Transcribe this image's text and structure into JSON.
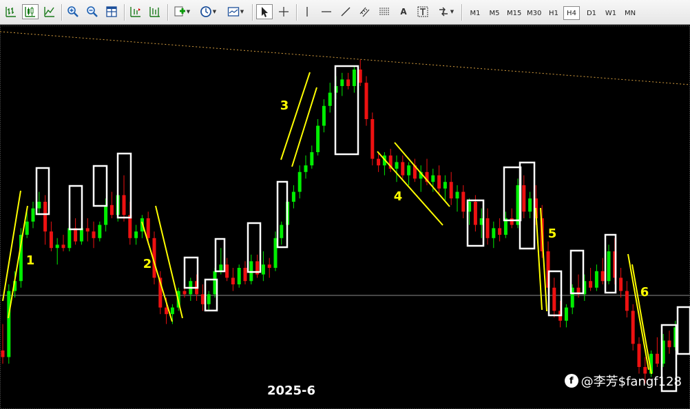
{
  "toolbar": {
    "timeframes": [
      {
        "label": "M1",
        "active": false
      },
      {
        "label": "M5",
        "active": false
      },
      {
        "label": "M15",
        "active": false
      },
      {
        "label": "M30",
        "active": false
      },
      {
        "label": "H1",
        "active": false
      },
      {
        "label": "H4",
        "active": true
      },
      {
        "label": "D1",
        "active": false
      },
      {
        "label": "W1",
        "active": false
      },
      {
        "label": "MN",
        "active": false
      }
    ],
    "tools": {
      "text_tool_label": "A"
    },
    "icons": [
      "bar-chart-icon",
      "candlestick-icon",
      "line-chart-icon",
      "zoom-in-icon",
      "zoom-out-icon",
      "tile-windows-icon",
      "chart-shift-icon",
      "autoscroll-icon",
      "new-indicator-icon",
      "periods-clock-icon",
      "templates-icon",
      "cursor-icon",
      "crosshair-icon",
      "vertical-line-icon",
      "horizontal-line-icon",
      "trendline-icon",
      "equidistant-channel-icon",
      "fibonacci-icon",
      "text-label-icon",
      "arrows-icon"
    ]
  },
  "chart": {
    "period_label": "2025-6",
    "watermark": "@李芳$fangf128",
    "wave_labels": [
      "1",
      "2",
      "3",
      "4",
      "5",
      "6"
    ],
    "colors": {
      "background": "#000000",
      "bull": "#00ee00",
      "bear": "#ee1111",
      "annotation": "#ffff00",
      "box": "#ffffff",
      "resistance": "#d8a040",
      "hline": "#8c8c8c"
    }
  },
  "chart_data": {
    "type": "candlestick",
    "timeframe": "H4",
    "title": "",
    "xlabel": "2025-6",
    "ylabel": "",
    "ohlc_relative": [
      [
        0.1,
        0.18,
        0.06,
        0.08
      ],
      [
        0.08,
        0.3,
        0.06,
        0.28
      ],
      [
        0.28,
        0.34,
        0.26,
        0.31
      ],
      [
        0.31,
        0.47,
        0.29,
        0.45
      ],
      [
        0.45,
        0.52,
        0.44,
        0.49
      ],
      [
        0.49,
        0.55,
        0.47,
        0.53
      ],
      [
        0.53,
        0.58,
        0.51,
        0.55
      ],
      [
        0.55,
        0.57,
        0.42,
        0.46
      ],
      [
        0.46,
        0.49,
        0.4,
        0.41
      ],
      [
        0.41,
        0.44,
        0.36,
        0.42
      ],
      [
        0.42,
        0.45,
        0.4,
        0.41
      ],
      [
        0.41,
        0.5,
        0.4,
        0.47
      ],
      [
        0.47,
        0.5,
        0.42,
        0.43
      ],
      [
        0.43,
        0.49,
        0.42,
        0.47
      ],
      [
        0.47,
        0.5,
        0.43,
        0.46
      ],
      [
        0.46,
        0.49,
        0.41,
        0.44
      ],
      [
        0.44,
        0.49,
        0.43,
        0.48
      ],
      [
        0.48,
        0.56,
        0.46,
        0.54
      ],
      [
        0.54,
        0.58,
        0.5,
        0.51
      ],
      [
        0.51,
        0.6,
        0.49,
        0.57
      ],
      [
        0.57,
        0.63,
        0.49,
        0.51
      ],
      [
        0.51,
        0.55,
        0.42,
        0.44
      ],
      [
        0.44,
        0.48,
        0.42,
        0.46
      ],
      [
        0.46,
        0.51,
        0.44,
        0.5
      ],
      [
        0.5,
        0.52,
        0.42,
        0.44
      ],
      [
        0.44,
        0.46,
        0.3,
        0.32
      ],
      [
        0.32,
        0.34,
        0.21,
        0.23
      ],
      [
        0.23,
        0.26,
        0.18,
        0.21
      ],
      [
        0.21,
        0.24,
        0.18,
        0.23
      ],
      [
        0.23,
        0.29,
        0.22,
        0.28
      ],
      [
        0.28,
        0.3,
        0.26,
        0.27
      ],
      [
        0.27,
        0.32,
        0.25,
        0.31
      ],
      [
        0.31,
        0.33,
        0.25,
        0.27
      ],
      [
        0.27,
        0.3,
        0.22,
        0.24
      ],
      [
        0.24,
        0.28,
        0.22,
        0.27
      ],
      [
        0.27,
        0.35,
        0.26,
        0.34
      ],
      [
        0.34,
        0.41,
        0.33,
        0.36
      ],
      [
        0.36,
        0.38,
        0.31,
        0.32
      ],
      [
        0.32,
        0.35,
        0.28,
        0.3
      ],
      [
        0.3,
        0.36,
        0.29,
        0.35
      ],
      [
        0.35,
        0.37,
        0.3,
        0.31
      ],
      [
        0.31,
        0.39,
        0.3,
        0.37
      ],
      [
        0.37,
        0.39,
        0.32,
        0.33
      ],
      [
        0.33,
        0.4,
        0.31,
        0.36
      ],
      [
        0.36,
        0.38,
        0.32,
        0.35
      ],
      [
        0.35,
        0.46,
        0.34,
        0.44
      ],
      [
        0.44,
        0.49,
        0.42,
        0.48
      ],
      [
        0.48,
        0.56,
        0.46,
        0.55
      ],
      [
        0.55,
        0.6,
        0.53,
        0.58
      ],
      [
        0.58,
        0.66,
        0.56,
        0.64
      ],
      [
        0.64,
        0.69,
        0.62,
        0.66
      ],
      [
        0.66,
        0.72,
        0.65,
        0.7
      ],
      [
        0.7,
        0.8,
        0.69,
        0.78
      ],
      [
        0.78,
        0.86,
        0.76,
        0.84
      ],
      [
        0.84,
        0.91,
        0.82,
        0.88
      ],
      [
        0.88,
        0.93,
        0.86,
        0.9
      ],
      [
        0.9,
        0.94,
        0.87,
        0.92
      ],
      [
        0.92,
        0.94,
        0.89,
        0.9
      ],
      [
        0.9,
        0.96,
        0.88,
        0.95
      ],
      [
        0.95,
        0.98,
        0.9,
        0.91
      ],
      [
        0.91,
        0.93,
        0.78,
        0.8
      ],
      [
        0.8,
        0.82,
        0.66,
        0.68
      ],
      [
        0.68,
        0.7,
        0.64,
        0.66
      ],
      [
        0.66,
        0.7,
        0.63,
        0.69
      ],
      [
        0.69,
        0.71,
        0.64,
        0.65
      ],
      [
        0.65,
        0.69,
        0.61,
        0.67
      ],
      [
        0.67,
        0.69,
        0.62,
        0.63
      ],
      [
        0.63,
        0.67,
        0.6,
        0.66
      ],
      [
        0.66,
        0.68,
        0.61,
        0.62
      ],
      [
        0.62,
        0.66,
        0.58,
        0.64
      ],
      [
        0.64,
        0.68,
        0.6,
        0.61
      ],
      [
        0.61,
        0.65,
        0.58,
        0.63
      ],
      [
        0.63,
        0.66,
        0.57,
        0.59
      ],
      [
        0.59,
        0.63,
        0.55,
        0.61
      ],
      [
        0.61,
        0.64,
        0.54,
        0.56
      ],
      [
        0.56,
        0.6,
        0.52,
        0.58
      ],
      [
        0.58,
        0.6,
        0.5,
        0.52
      ],
      [
        0.52,
        0.56,
        0.48,
        0.55
      ],
      [
        0.55,
        0.57,
        0.46,
        0.48
      ],
      [
        0.48,
        0.53,
        0.44,
        0.5
      ],
      [
        0.5,
        0.53,
        0.42,
        0.44
      ],
      [
        0.44,
        0.49,
        0.41,
        0.47
      ],
      [
        0.47,
        0.5,
        0.43,
        0.45
      ],
      [
        0.45,
        0.52,
        0.44,
        0.5
      ],
      [
        0.5,
        0.53,
        0.47,
        0.48
      ],
      [
        0.48,
        0.62,
        0.47,
        0.6
      ],
      [
        0.6,
        0.63,
        0.5,
        0.52
      ],
      [
        0.52,
        0.58,
        0.5,
        0.56
      ],
      [
        0.56,
        0.6,
        0.48,
        0.5
      ],
      [
        0.5,
        0.54,
        0.38,
        0.4
      ],
      [
        0.4,
        0.43,
        0.27,
        0.29
      ],
      [
        0.29,
        0.32,
        0.2,
        0.22
      ],
      [
        0.22,
        0.25,
        0.17,
        0.19
      ],
      [
        0.19,
        0.24,
        0.17,
        0.23
      ],
      [
        0.23,
        0.3,
        0.21,
        0.29
      ],
      [
        0.29,
        0.33,
        0.26,
        0.27
      ],
      [
        0.27,
        0.33,
        0.25,
        0.31
      ],
      [
        0.31,
        0.35,
        0.28,
        0.29
      ],
      [
        0.29,
        0.36,
        0.28,
        0.34
      ],
      [
        0.34,
        0.38,
        0.3,
        0.31
      ],
      [
        0.31,
        0.42,
        0.3,
        0.4
      ],
      [
        0.4,
        0.44,
        0.3,
        0.32
      ],
      [
        0.32,
        0.35,
        0.26,
        0.28
      ],
      [
        0.28,
        0.31,
        0.2,
        0.22
      ],
      [
        0.22,
        0.24,
        0.1,
        0.12
      ],
      [
        0.12,
        0.14,
        0.03,
        0.05
      ],
      [
        0.05,
        0.08,
        0.0,
        0.03
      ],
      [
        0.03,
        0.1,
        0.02,
        0.09
      ],
      [
        0.09,
        0.14,
        0.05,
        0.06
      ],
      [
        0.06,
        0.15,
        0.05,
        0.13
      ],
      [
        0.13,
        0.16,
        0.09,
        0.11
      ],
      [
        0.11,
        0.19,
        0.1,
        0.17
      ]
    ]
  }
}
